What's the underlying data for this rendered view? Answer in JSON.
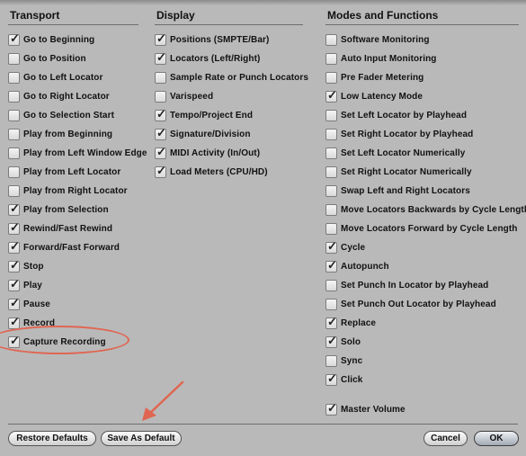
{
  "columns": [
    {
      "title": "Transport",
      "items": [
        {
          "label": "Go to Beginning",
          "checked": true
        },
        {
          "label": "Go to Position",
          "checked": false
        },
        {
          "label": "Go to Left Locator",
          "checked": false
        },
        {
          "label": "Go to Right Locator",
          "checked": false
        },
        {
          "label": "Go to Selection Start",
          "checked": false
        },
        {
          "label": "Play from Beginning",
          "checked": false
        },
        {
          "label": "Play from Left Window Edge",
          "checked": false
        },
        {
          "label": "Play from Left Locator",
          "checked": false
        },
        {
          "label": "Play from Right Locator",
          "checked": false
        },
        {
          "label": "Play from Selection",
          "checked": true
        },
        {
          "label": "Rewind/Fast Rewind",
          "checked": true
        },
        {
          "label": "Forward/Fast Forward",
          "checked": true
        },
        {
          "label": "Stop",
          "checked": true
        },
        {
          "label": "Play",
          "checked": true
        },
        {
          "label": "Pause",
          "checked": true
        },
        {
          "label": "Record",
          "checked": true
        },
        {
          "label": "Capture Recording",
          "checked": true
        }
      ]
    },
    {
      "title": "Display",
      "items": [
        {
          "label": "Positions (SMPTE/Bar)",
          "checked": true
        },
        {
          "label": "Locators (Left/Right)",
          "checked": true
        },
        {
          "label": "Sample Rate or Punch Locators",
          "checked": false
        },
        {
          "label": "Varispeed",
          "checked": false
        },
        {
          "label": "Tempo/Project End",
          "checked": true
        },
        {
          "label": "Signature/Division",
          "checked": true
        },
        {
          "label": "MIDI Activity (In/Out)",
          "checked": true
        },
        {
          "label": "Load Meters (CPU/HD)",
          "checked": true
        }
      ]
    },
    {
      "title": "Modes and Functions",
      "items": [
        {
          "label": "Software Monitoring",
          "checked": false
        },
        {
          "label": "Auto Input Monitoring",
          "checked": false
        },
        {
          "label": "Pre Fader Metering",
          "checked": false
        },
        {
          "label": "Low Latency Mode",
          "checked": true
        },
        {
          "label": "Set Left Locator by Playhead",
          "checked": false
        },
        {
          "label": "Set Right Locator by Playhead",
          "checked": false
        },
        {
          "label": "Set Left Locator Numerically",
          "checked": false
        },
        {
          "label": "Set Right Locator Numerically",
          "checked": false
        },
        {
          "label": "Swap Left and Right Locators",
          "checked": false
        },
        {
          "label": "Move Locators Backwards by Cycle Length",
          "checked": false
        },
        {
          "label": "Move Locators Forward by Cycle Length",
          "checked": false
        },
        {
          "label": "Cycle",
          "checked": true
        },
        {
          "label": "Autopunch",
          "checked": true
        },
        {
          "label": "Set Punch In Locator by Playhead",
          "checked": false
        },
        {
          "label": "Set Punch Out Locator by Playhead",
          "checked": false
        },
        {
          "label": "Replace",
          "checked": true
        },
        {
          "label": "Solo",
          "checked": true
        },
        {
          "label": "Sync",
          "checked": false
        },
        {
          "label": "Click",
          "checked": true
        },
        {
          "label": "Master Volume",
          "checked": true,
          "spaced": true
        }
      ]
    }
  ],
  "buttons": {
    "restore_defaults": "Restore Defaults",
    "save_as_default": "Save As Default",
    "cancel": "Cancel",
    "ok": "OK"
  },
  "annotations": {
    "highlight_color": "#e06652",
    "highlighted_item": "Capture Recording",
    "arrow_target": "Save As Default"
  }
}
